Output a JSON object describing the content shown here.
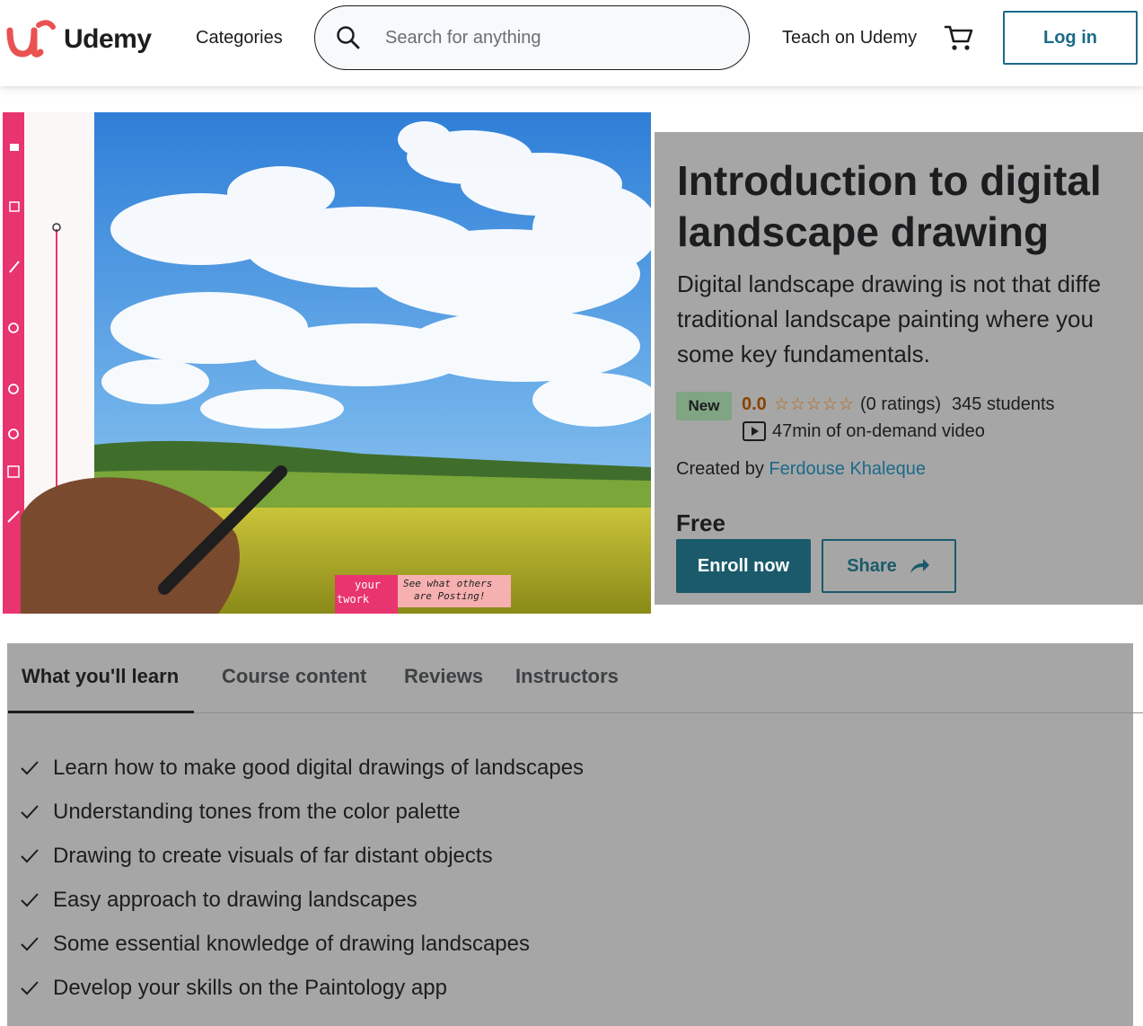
{
  "header": {
    "logo_text": "Udemy",
    "categories_label": "Categories",
    "search_placeholder": "Search for anything",
    "teach_label": "Teach on Udemy",
    "cart_icon": "cart-icon",
    "login_label": "Log in",
    "brand_color": "#a435f0",
    "accent_color": "#1c6a8a"
  },
  "hero": {
    "image_overlay_text_1": "your",
    "image_overlay_text_2": "twork",
    "image_overlay_text_3": "See what others",
    "image_overlay_text_4": "are Posting!"
  },
  "course": {
    "title": "Introduction to digital landscape drawing",
    "subtitle_line_1": "Digital landscape drawing is not that diffe",
    "subtitle_line_2": "traditional landscape painting where you",
    "subtitle_line_3": "some key fundamentals.",
    "badge": "New",
    "rating_value": "0.0",
    "stars_display": "☆☆☆☆☆",
    "ratings_count": "(0 ratings)",
    "students": "345 students",
    "video_length": "47min of on-demand video",
    "created_by_label": "Created by",
    "author": "Ferdouse Khaleque",
    "price": "Free",
    "enroll_label": "Enroll now",
    "share_label": "Share"
  },
  "tabs": [
    {
      "label": "What you'll learn",
      "active": true
    },
    {
      "label": "Course content",
      "active": false
    },
    {
      "label": "Reviews",
      "active": false
    },
    {
      "label": "Instructors",
      "active": false
    }
  ],
  "learn_items": [
    "Learn how to make good digital drawings of landscapes",
    "Understanding tones from the color palette",
    "Drawing to create visuals of far distant objects",
    "Easy approach to drawing landscapes",
    "Some essential knowledge of drawing landscapes",
    "Develop your skills on the Paintology app"
  ]
}
